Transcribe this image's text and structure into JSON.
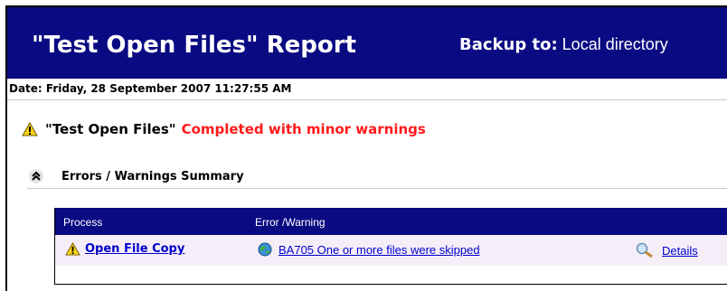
{
  "header": {
    "title": "\"Test Open Files\" Report",
    "backup_label": "Backup to",
    "backup_sep": ":",
    "backup_value": "Local directory"
  },
  "date_line": "Date: Friday, 28 September 2007 11:27:55 AM",
  "status": {
    "job_name": "\"Test Open Files\"",
    "result": "Completed with minor warnings",
    "icon": "warning-icon",
    "result_color": "#ff1a1a"
  },
  "summary": {
    "title": "Errors / Warnings Summary",
    "icon": "collapse-up-icon"
  },
  "table": {
    "headers": [
      "Process",
      "Error /Warning"
    ],
    "rows": [
      {
        "process": "Open File Copy",
        "error": "BA705 One or more files were skipped",
        "details": "Details"
      }
    ]
  },
  "colors": {
    "banner": "#0a0a82",
    "row_bg": "#f5eef8",
    "link": "#0000cc"
  }
}
